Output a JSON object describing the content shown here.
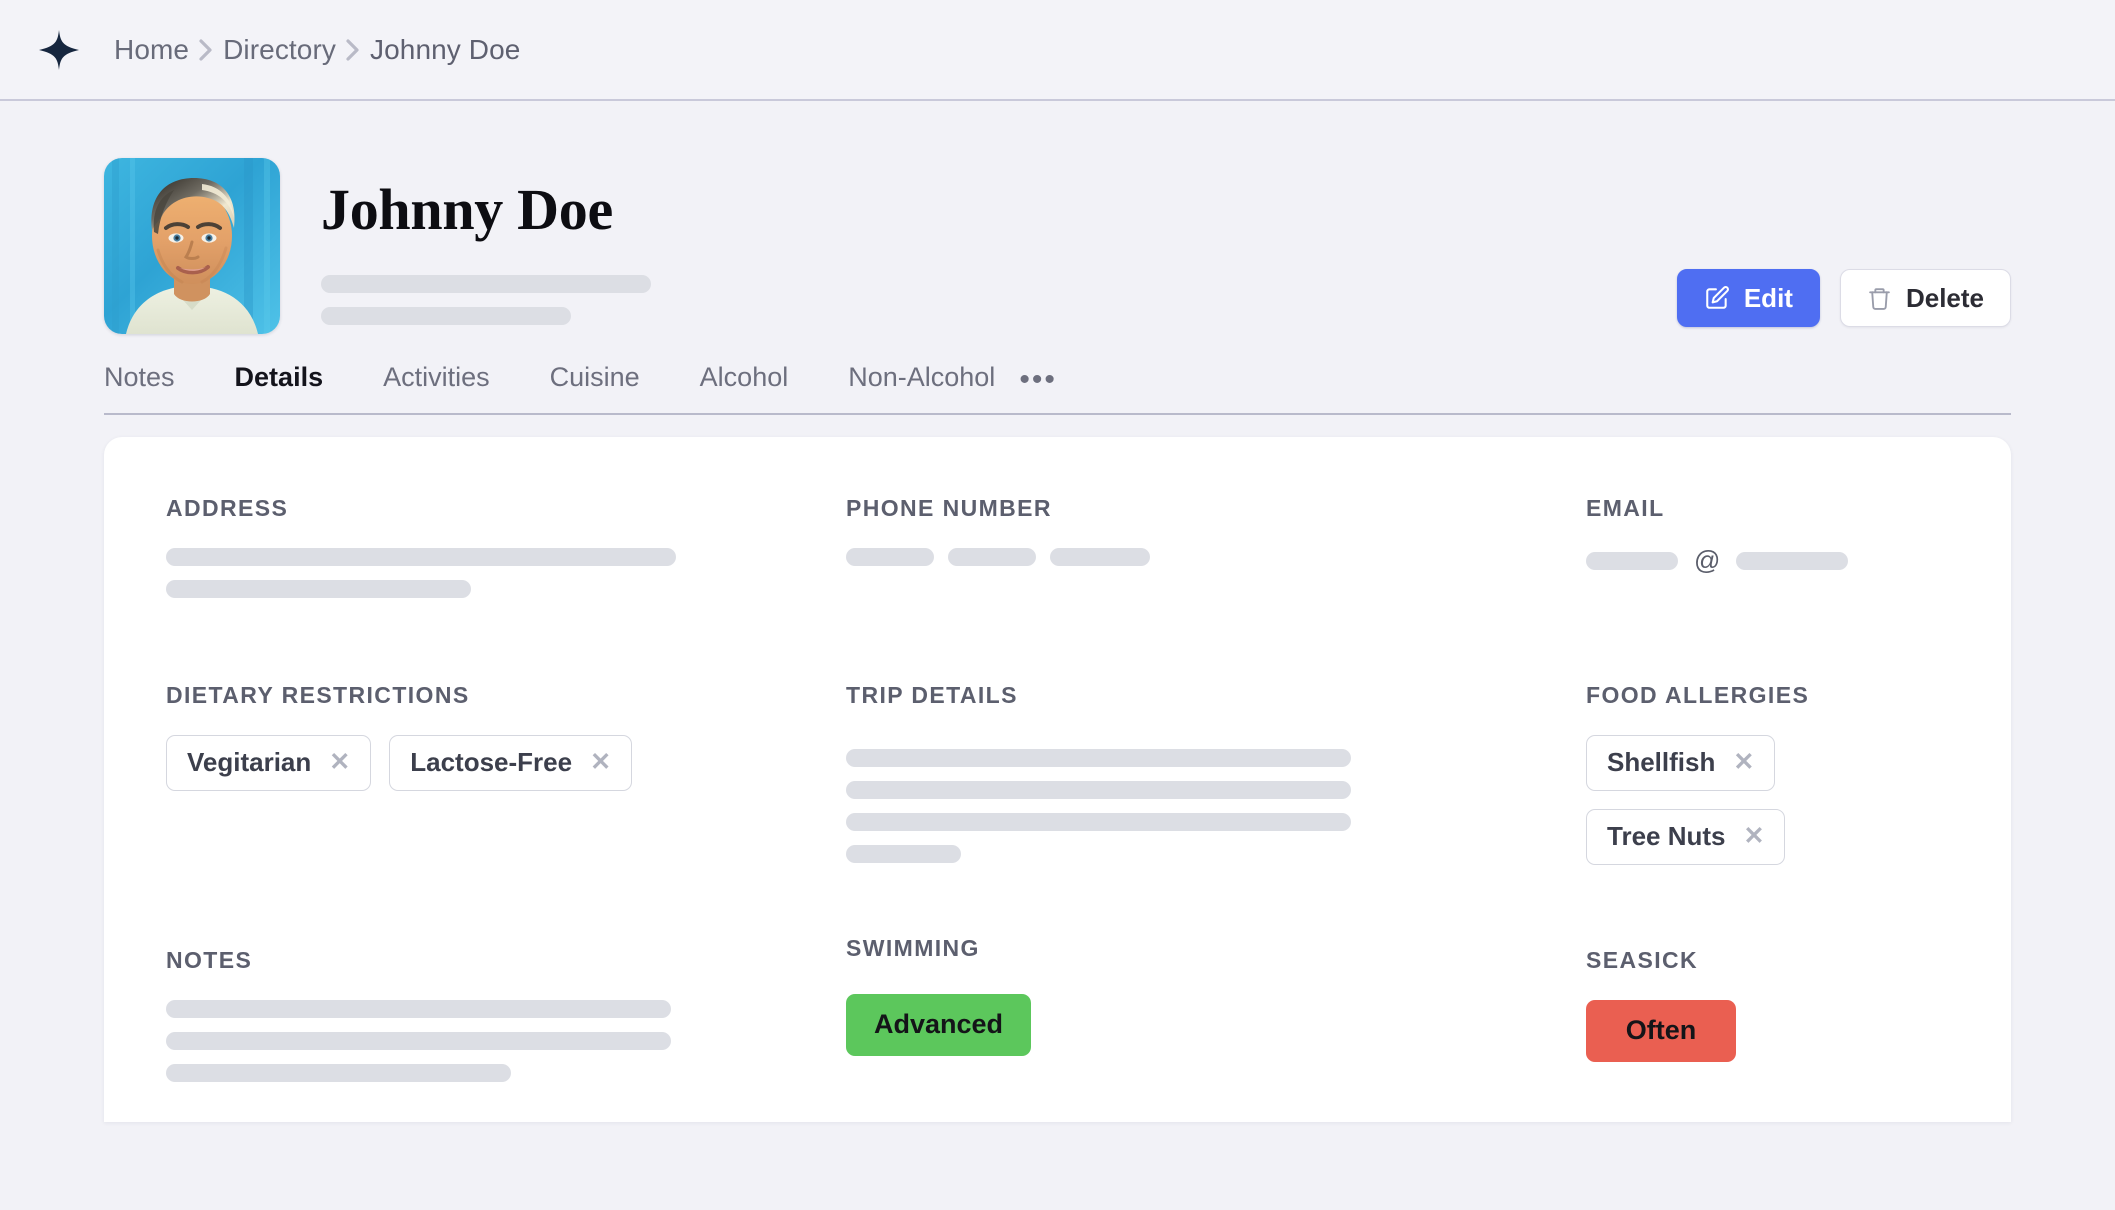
{
  "app": {
    "logo_icon": "sparkle-star-icon",
    "logo_color": "#16263f",
    "background_color": "#f2f2f7",
    "accent_color": "#4f6ef2"
  },
  "breadcrumb": {
    "items": [
      {
        "label": "Home"
      },
      {
        "label": "Directory"
      },
      {
        "label": "Johnny Doe"
      }
    ],
    "separator_icon": "chevron-right-icon"
  },
  "profile": {
    "name": "Johnny Doe",
    "avatar_alt": "painted portrait of a man on a blue background",
    "subtitle_placeholders": 2
  },
  "actions": {
    "edit": {
      "label": "Edit",
      "icon": "pencil-square-icon"
    },
    "delete": {
      "label": "Delete",
      "icon": "trash-icon"
    }
  },
  "tabs": {
    "items": [
      {
        "label": "Notes",
        "active": false
      },
      {
        "label": "Details",
        "active": true
      },
      {
        "label": "Activities",
        "active": false
      },
      {
        "label": "Cuisine",
        "active": false
      },
      {
        "label": "Alcohol",
        "active": false
      },
      {
        "label": "Non-Alcohol",
        "active": false
      }
    ],
    "overflow_label": "•••"
  },
  "details": {
    "address": {
      "label": "ADDRESS"
    },
    "phone": {
      "label": "PHONE NUMBER"
    },
    "email": {
      "label": "EMAIL",
      "at_symbol": "@"
    },
    "dietary": {
      "label": "DIETARY RESTRICTIONS",
      "chips": [
        {
          "label": "Vegitarian",
          "remove_icon": "close-icon"
        },
        {
          "label": "Lactose-Free",
          "remove_icon": "close-icon"
        }
      ]
    },
    "trip": {
      "label": "TRIP DETAILS"
    },
    "allergies": {
      "label": "FOOD ALLERGIES",
      "chips": [
        {
          "label": "Shellfish",
          "remove_icon": "close-icon"
        },
        {
          "label": "Tree Nuts",
          "remove_icon": "close-icon"
        }
      ]
    },
    "notes": {
      "label": "NOTES"
    },
    "swimming": {
      "label": "SWIMMING",
      "value": "Advanced",
      "color": "#5cc75c"
    },
    "seasick": {
      "label": "SEASICK",
      "value": "Often",
      "color": "#ea5f51"
    }
  }
}
